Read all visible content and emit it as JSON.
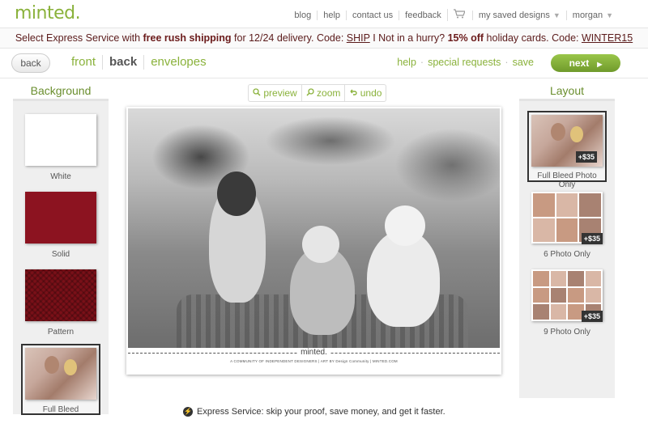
{
  "brand": {
    "logo": "minted."
  },
  "top_nav": {
    "links": [
      "blog",
      "help",
      "contact us",
      "feedback"
    ],
    "saved": "my saved designs",
    "user": "morgan"
  },
  "promo": {
    "pre": "Select Express Service with ",
    "bold1": "free rush shipping",
    "mid1": " for 12/24 delivery. Code: ",
    "code1": "SHIP",
    "mid2": " I Not in a hurry? ",
    "bold2": "15% off",
    "mid3": " holiday cards. Code: ",
    "code2": "WINTER15"
  },
  "steps": {
    "back_label": "back",
    "tabs": [
      "front",
      "back",
      "envelopes"
    ],
    "help": "help",
    "special": "special requests",
    "save": "save",
    "next_label": "next"
  },
  "background_panel": {
    "title": "Background",
    "items": [
      {
        "label": "White"
      },
      {
        "label": "Solid"
      },
      {
        "label": "Pattern"
      },
      {
        "label": "Full Bleed"
      }
    ],
    "selected": "Full Bleed"
  },
  "layout_panel": {
    "title": "Layout",
    "items": [
      {
        "label": "Full Bleed Photo Only",
        "price": "+$35"
      },
      {
        "label": "6 Photo Only",
        "price": "+$35"
      },
      {
        "label": "9 Photo Only",
        "price": "+$35"
      }
    ],
    "selected": "Full Bleed Photo Only"
  },
  "tools": {
    "preview": "preview",
    "zoom": "zoom",
    "undo": "undo"
  },
  "card": {
    "brand": "minted.",
    "fine_print": "A COMMUNITY OF INDEPENDENT DESIGNERS  |  ART BY Design Community  |  MINTED.COM"
  },
  "express_note": "Express Service: skip your proof, save money, and get it faster.",
  "colors": {
    "accent": "#8ab23b",
    "promo_text": "#6b1b1b",
    "solid": "#8c1320"
  }
}
